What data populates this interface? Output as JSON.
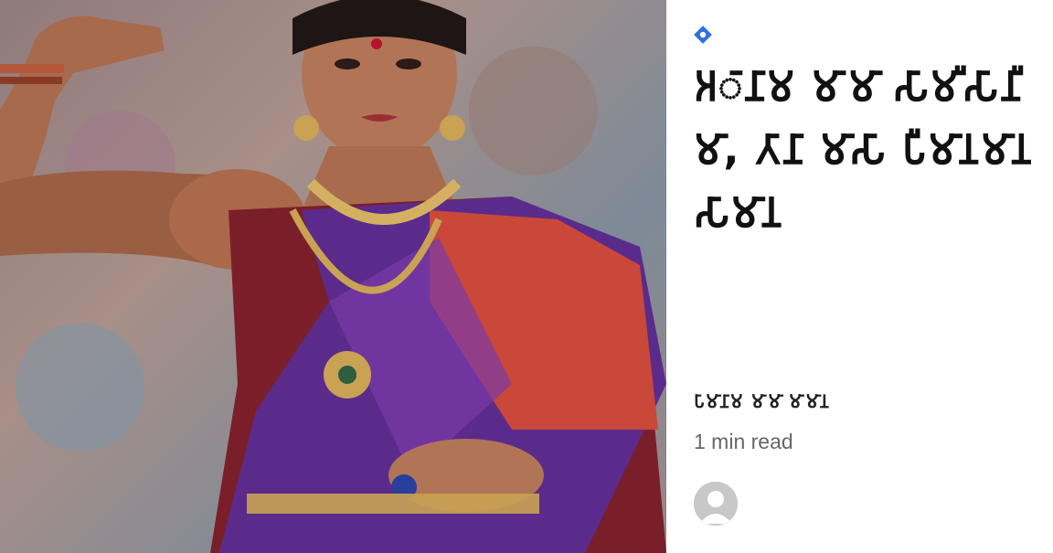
{
  "post": {
    "category_icon": "diamond-category-icon",
    "title": "𑀅𑀸𑀦𑀸𑀫 𑀫𑀸𑀫𑀸 𑀲𑀸𑀫𑀻𑀲𑀸𑀦𑀻𑀫𑀸, 𑀢𑀸𑀦𑀸 𑀫𑀸𑀲𑀸 𑀧𑀻𑀫𑀸𑀦𑀫𑀸𑀦 𑀲𑀸𑀫𑀸𑀦",
    "author": "𑀧𑀸𑀫𑀸𑀦𑀸𑀫 𑀫𑀸𑀫𑀸 𑀫𑀸𑀫𑀸𑀦",
    "read_time": "1 min read",
    "avatar_icon": "default-user-avatar-icon"
  },
  "colors": {
    "accent": "#2f6fe0",
    "title": "#111111",
    "meta": "#666666",
    "avatar_bg": "#c8c8c8"
  }
}
